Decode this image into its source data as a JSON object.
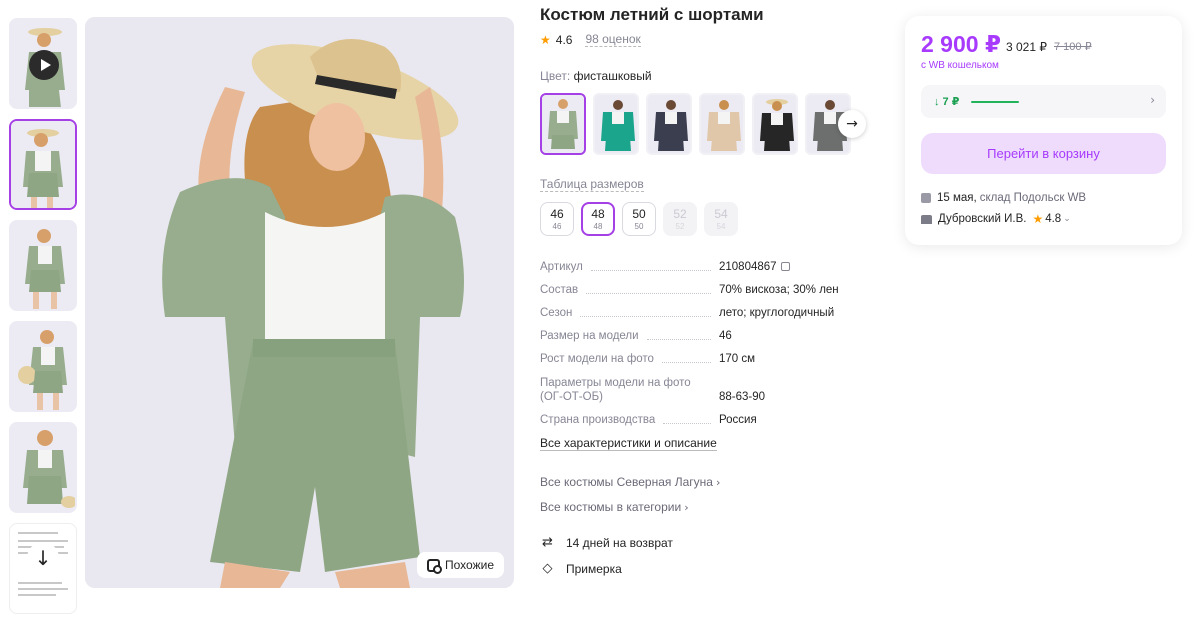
{
  "product": {
    "title": "Костюм летний с шортами",
    "rating": "4.6",
    "reviews": "98 оценок",
    "color_label": "Цвет:",
    "color_value": "фисташковый",
    "similar_label": "Похожие"
  },
  "sizes": {
    "table_label": "Таблица размеров",
    "items": [
      {
        "main": "46",
        "sub": "46",
        "state": "normal"
      },
      {
        "main": "48",
        "sub": "48",
        "state": "selected"
      },
      {
        "main": "50",
        "sub": "50",
        "state": "normal"
      },
      {
        "main": "52",
        "sub": "52",
        "state": "disabled"
      },
      {
        "main": "54",
        "sub": "54",
        "state": "disabled"
      }
    ]
  },
  "specs": [
    {
      "name": "Артикул",
      "value": "210804867"
    },
    {
      "name": "Состав",
      "value": "70% вискоза; 30% лен"
    },
    {
      "name": "Сезон",
      "value": "лето; круглогодичный"
    },
    {
      "name": "Размер на модели",
      "value": "46"
    },
    {
      "name": "Рост модели на фото",
      "value": "170 см"
    },
    {
      "name": "Параметры модели на фото (ОГ-ОТ-ОБ)",
      "value": "88-63-90"
    },
    {
      "name": "Страна производства",
      "value": "Россия"
    }
  ],
  "links": {
    "all_chars": "Все характеристики и описание",
    "brand": "Все костюмы Северная Лагуна",
    "category": "Все костюмы в категории"
  },
  "features": {
    "return": "14 дней на возврат",
    "fitting": "Примерка"
  },
  "price_card": {
    "price": "2 900 ₽",
    "price_mid": "3 021 ₽",
    "price_old": "7 100 ₽",
    "wallet": "с WB кошельком",
    "drop": "↓ 7 ₽",
    "cart_button": "Перейти в корзину",
    "delivery_date": "15 мая,",
    "delivery_place": "склад Подольск WB",
    "seller": "Дубровский И.В.",
    "seller_rating": "4.8"
  },
  "colors": {
    "accent": "#a73afd",
    "green": "#22b35b",
    "suit": "#97ad8d",
    "suit_dark": "#7f9676"
  },
  "icons": [
    "play-icon",
    "arrow-down-icon",
    "arrow-right-icon",
    "copy-icon",
    "return-icon",
    "tag-icon",
    "search-similar-icon",
    "chevron-right-icon",
    "star-icon",
    "box-icon",
    "shop-icon"
  ]
}
